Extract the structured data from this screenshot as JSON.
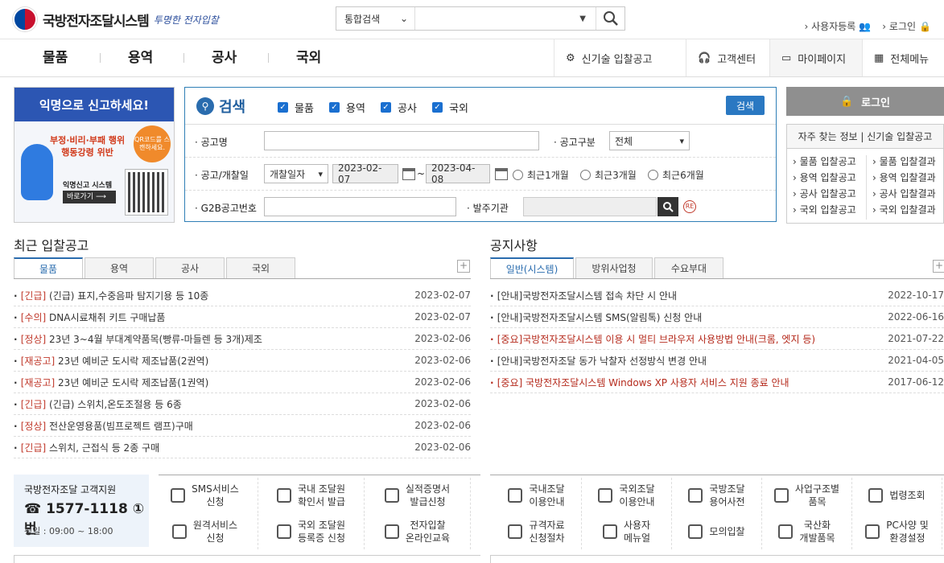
{
  "header": {
    "site_title": "국방전자조달시스템",
    "slogan": "투명한 전자입찰",
    "search": {
      "scope": "통합검색",
      "value": "",
      "placeholder": "",
      "side_text": "▼"
    },
    "links": [
      "사용자등록",
      "로그인"
    ]
  },
  "gnb": {
    "items": [
      "물품",
      "용역",
      "공사",
      "국외"
    ],
    "utils": [
      {
        "label": "신기술 입찰공고",
        "icon": "newtech-icon"
      },
      {
        "label": "고객센터",
        "icon": "headset-icon"
      },
      {
        "label": "마이페이지",
        "icon": "box-icon"
      },
      {
        "label": "전체메뉴",
        "icon": "grid-icon"
      }
    ]
  },
  "banner": {
    "head": "익명으로 신고하세요!",
    "sub1": "부정·비리·부패 행위",
    "sub2": "행동강령 위반",
    "qr": "QR코드를 스캔하세요.",
    "brand": "익명신고 시스템",
    "go": "바로가기 ⟶"
  },
  "search_panel": {
    "title": "검색",
    "button": "검색",
    "types": [
      "물품",
      "용역",
      "공사",
      "국외"
    ],
    "labels": {
      "name": "공고명",
      "kind": "공고구분",
      "date": "공고/개찰일",
      "g2b": "G2B공고번호",
      "org": "발주기관"
    },
    "kind_value": "전체",
    "date_type": "개찰일자",
    "date_from": "2023-02-07",
    "date_to": "2023-04-08",
    "tilde": "~",
    "ranges": [
      "최근1개월",
      "최근3개월",
      "최근6개월"
    ]
  },
  "login": {
    "button": "로그인"
  },
  "faq": {
    "title": "자주 찾는 정보 | 신기술 입찰공고",
    "left": [
      "물품 입찰공고",
      "용역 입찰공고",
      "공사 입찰공고",
      "국외 입찰공고"
    ],
    "right": [
      "물품 입찰결과",
      "용역 입찰결과",
      "공사 입찰결과",
      "국외 입찰결과"
    ]
  },
  "recent": {
    "title": "최근 입찰공고",
    "tabs": [
      "물품",
      "용역",
      "공사",
      "국외"
    ],
    "plus": "+",
    "rows": [
      {
        "tag": "[긴급]",
        "text": " (긴급) 표지,수중음파 탐지기용 등 10종",
        "date": "2023-02-07"
      },
      {
        "tag": "[수의]",
        "text": " DNA시료채취 키트 구매납품",
        "date": "2023-02-07"
      },
      {
        "tag": "[정상]",
        "text": " 23년 3~4월 부대계약품목(빵류-마들렌 등 3개)제조",
        "date": "2023-02-06"
      },
      {
        "tag": "[재공고]",
        "text": " 23년 예비군 도시락 제조납품(2권역)",
        "date": "2023-02-06"
      },
      {
        "tag": "[재공고]",
        "text": " 23년 예비군 도시락 제조납품(1권역)",
        "date": "2023-02-06"
      },
      {
        "tag": "[긴급]",
        "text": " (긴급) 스위치,온도조절용 등 6종",
        "date": "2023-02-06"
      },
      {
        "tag": "[정상]",
        "text": " 전산운영용품(빔프로젝트 램프)구매",
        "date": "2023-02-06"
      },
      {
        "tag": "[긴급]",
        "text": " 스위치, 근접식 등 2종 구매",
        "date": "2023-02-06"
      }
    ]
  },
  "notice": {
    "title": "공지사항",
    "tabs": [
      "일반(시스템)",
      "방위사업청",
      "수요부대"
    ],
    "plus": "+",
    "rows": [
      {
        "text": "[안내]국방전자조달시스템 접속 차단 시 안내",
        "date": "2022-10-17",
        "red": false
      },
      {
        "text": "[안내]국방전자조달시스템 SMS(알림톡) 신청 안내",
        "date": "2022-06-16",
        "red": false
      },
      {
        "text": "[중요]국방전자조달시스템 이용 시 멀티 브라우저 사용방법 안내(크롬, 엣지 등)",
        "date": "2021-07-22",
        "red": true
      },
      {
        "text": "[안내]국방전자조달 동가 낙찰자 선정방식 변경 안내",
        "date": "2021-04-05",
        "red": false
      },
      {
        "text": "[중요] 국방전자조달시스템 Windows XP 사용자 서비스 지원 종료 안내",
        "date": "2017-06-12",
        "red": true
      }
    ]
  },
  "customer": {
    "title": "국방전자조달 고객지원",
    "phone": "1577-1118 ①번",
    "hours": "평일 : 09:00 ~ 18:00"
  },
  "services": [
    {
      "l1": "SMS서비스",
      "l2": "신청"
    },
    {
      "l1": "국내 조달원",
      "l2": "확인서 발급"
    },
    {
      "l1": "실적증명서",
      "l2": "발급신청"
    },
    {
      "l1": "원격서비스",
      "l2": "신청"
    },
    {
      "l1": "국외 조달원",
      "l2": "등록증 신청"
    },
    {
      "l1": "전자입찰",
      "l2": "온라인교육"
    }
  ],
  "quick": [
    {
      "l1": "국내조달",
      "l2": "이용안내"
    },
    {
      "l1": "국외조달",
      "l2": "이용안내"
    },
    {
      "l1": "국방조달",
      "l2": "용어사전"
    },
    {
      "l1": "사업구조별",
      "l2": "품목"
    },
    {
      "l1": "법령조회",
      "l2": ""
    },
    {
      "l1": "규격자료",
      "l2": "신청절차"
    },
    {
      "l1": "사용자",
      "l2": "메뉴얼"
    },
    {
      "l1": "모의입찰",
      "l2": ""
    },
    {
      "l1": "국산화",
      "l2": "개발품목"
    },
    {
      "l1": "PC사양 및",
      "l2": "환경설정"
    }
  ]
}
